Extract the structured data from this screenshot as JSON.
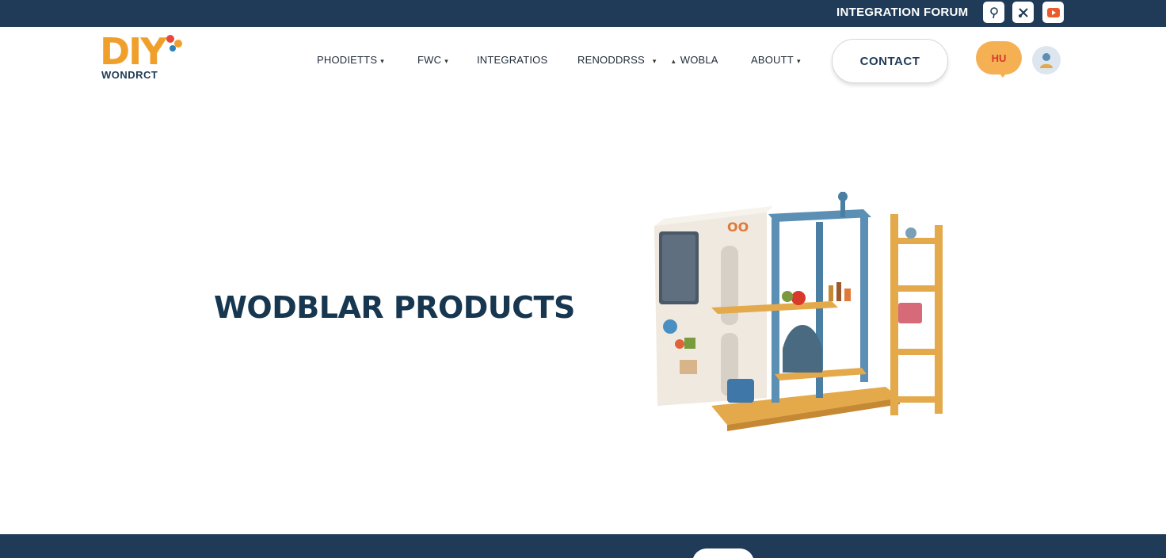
{
  "topbar": {
    "text": "INTEGRATION FORUM",
    "social_icons": [
      "pinterest-icon",
      "tools-icon",
      "youtube-icon"
    ]
  },
  "logo": {
    "main": "DIY",
    "sub": "WONDRCT"
  },
  "nav": {
    "items": [
      {
        "label": "PHODIETTS",
        "has_dropdown": true
      },
      {
        "label": "FWC",
        "has_dropdown": true
      },
      {
        "label": "INTEGRATIOS",
        "has_dropdown": false
      },
      {
        "label": "RENODDRSS",
        "has_dropdown": true
      },
      {
        "label": "WOBLA",
        "has_dropdown": true
      },
      {
        "label": "ABOUTT",
        "has_dropdown": true
      }
    ]
  },
  "contact_button": "CONTACT",
  "chat_bubble": "HU",
  "hero": {
    "title": "WODBLAR PRODUCTS"
  },
  "colors": {
    "navy": "#1f3b57",
    "accent_orange": "#f5b053",
    "accent_blue": "#5b8fb3",
    "wood": "#e3a94a"
  }
}
